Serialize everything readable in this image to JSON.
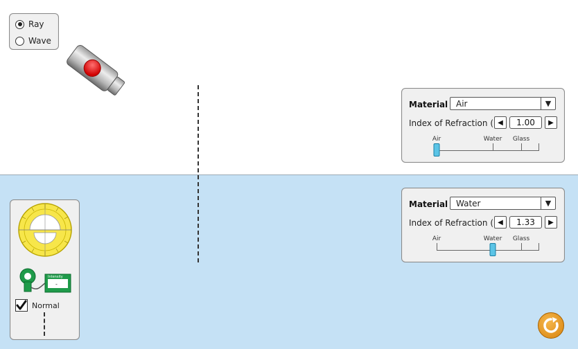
{
  "mode": {
    "options": [
      {
        "label": "Ray",
        "selected": true
      },
      {
        "label": "Wave",
        "selected": false
      }
    ]
  },
  "top_material": {
    "label": "Material",
    "selected": "Air",
    "ior_label": "Index of Refraction (n)",
    "ior_value": "1.00",
    "slider_ticks": [
      "Air",
      "Water",
      "Glass"
    ],
    "slider_position": 0.0
  },
  "bottom_material": {
    "label": "Material",
    "selected": "Water",
    "ior_label": "Index of Refraction (n)",
    "ior_value": "1.33",
    "slider_ticks": [
      "Air",
      "Water",
      "Glass"
    ],
    "slider_position": 0.55
  },
  "tools": {
    "normal_label": "Normal",
    "normal_checked": true,
    "intensity_label": "Intensity",
    "intensity_value": "-"
  },
  "icons": {
    "laser": "laser-pointer-icon",
    "protractor": "protractor-icon",
    "intensity_meter": "intensity-meter-icon",
    "reset": "reset-icon"
  },
  "colors": {
    "top_medium": "#ffffff",
    "bottom_medium": "#c5e1f5",
    "laser_button": "#e00000",
    "slider_thumb": "#5bc4e6",
    "reset": "#e8950f"
  }
}
